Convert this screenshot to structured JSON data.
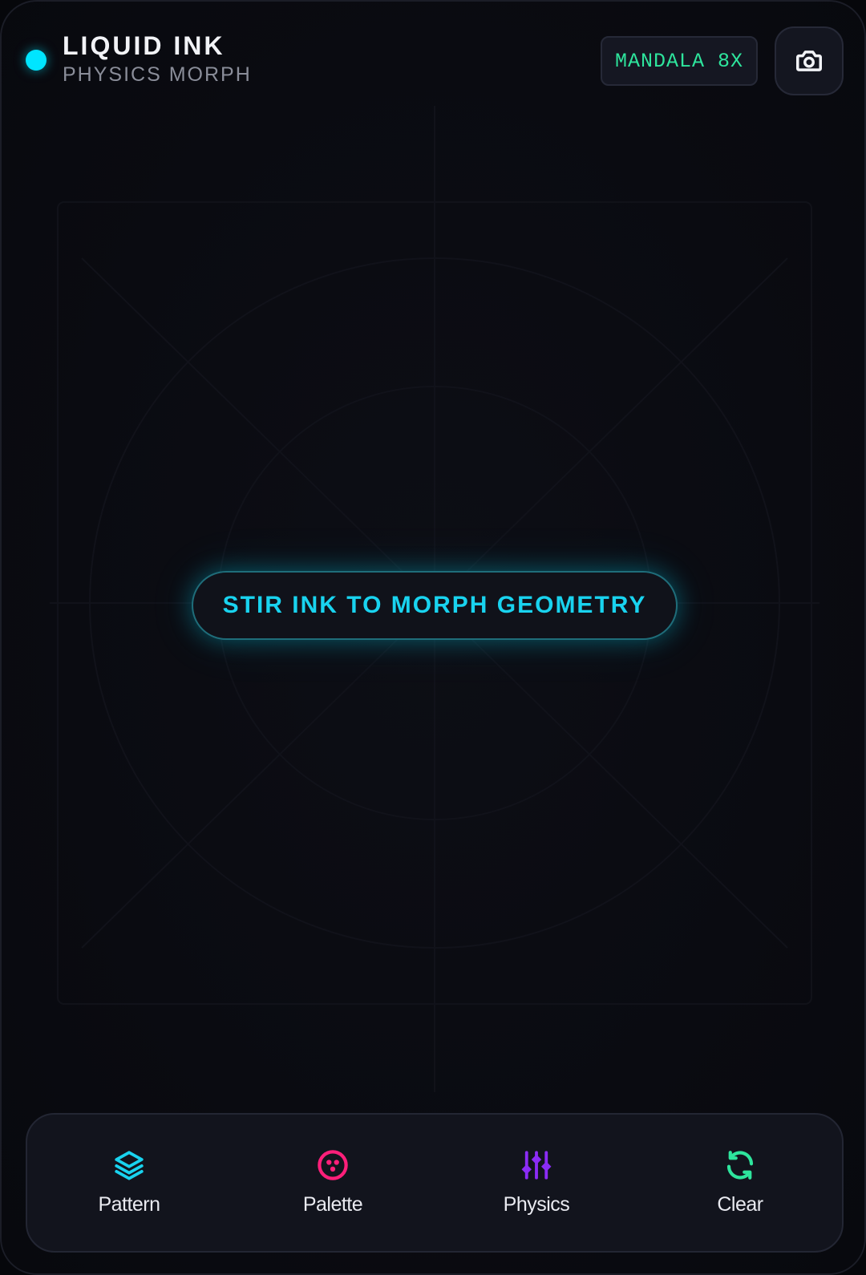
{
  "app": {
    "title": "LIQUID INK",
    "subtitle": "PHYSICS MORPH",
    "status_color": "#00e5ff"
  },
  "header": {
    "mode_badge": "MANDALA 8X",
    "mode_badge_color": "#2ee59d",
    "camera_icon": "camera-icon"
  },
  "canvas": {
    "hint": "STIR INK TO MORPH GEOMETRY",
    "hint_color": "#19d3ef"
  },
  "toolbar": {
    "items": [
      {
        "label": "Pattern",
        "icon": "layers-icon",
        "color": "#19d3ef"
      },
      {
        "label": "Palette",
        "icon": "palette-icon",
        "color": "#ff1f7a"
      },
      {
        "label": "Physics",
        "icon": "sliders-icon",
        "color": "#8b2cf5"
      },
      {
        "label": "Clear",
        "icon": "refresh-icon",
        "color": "#2ee59d"
      }
    ]
  }
}
